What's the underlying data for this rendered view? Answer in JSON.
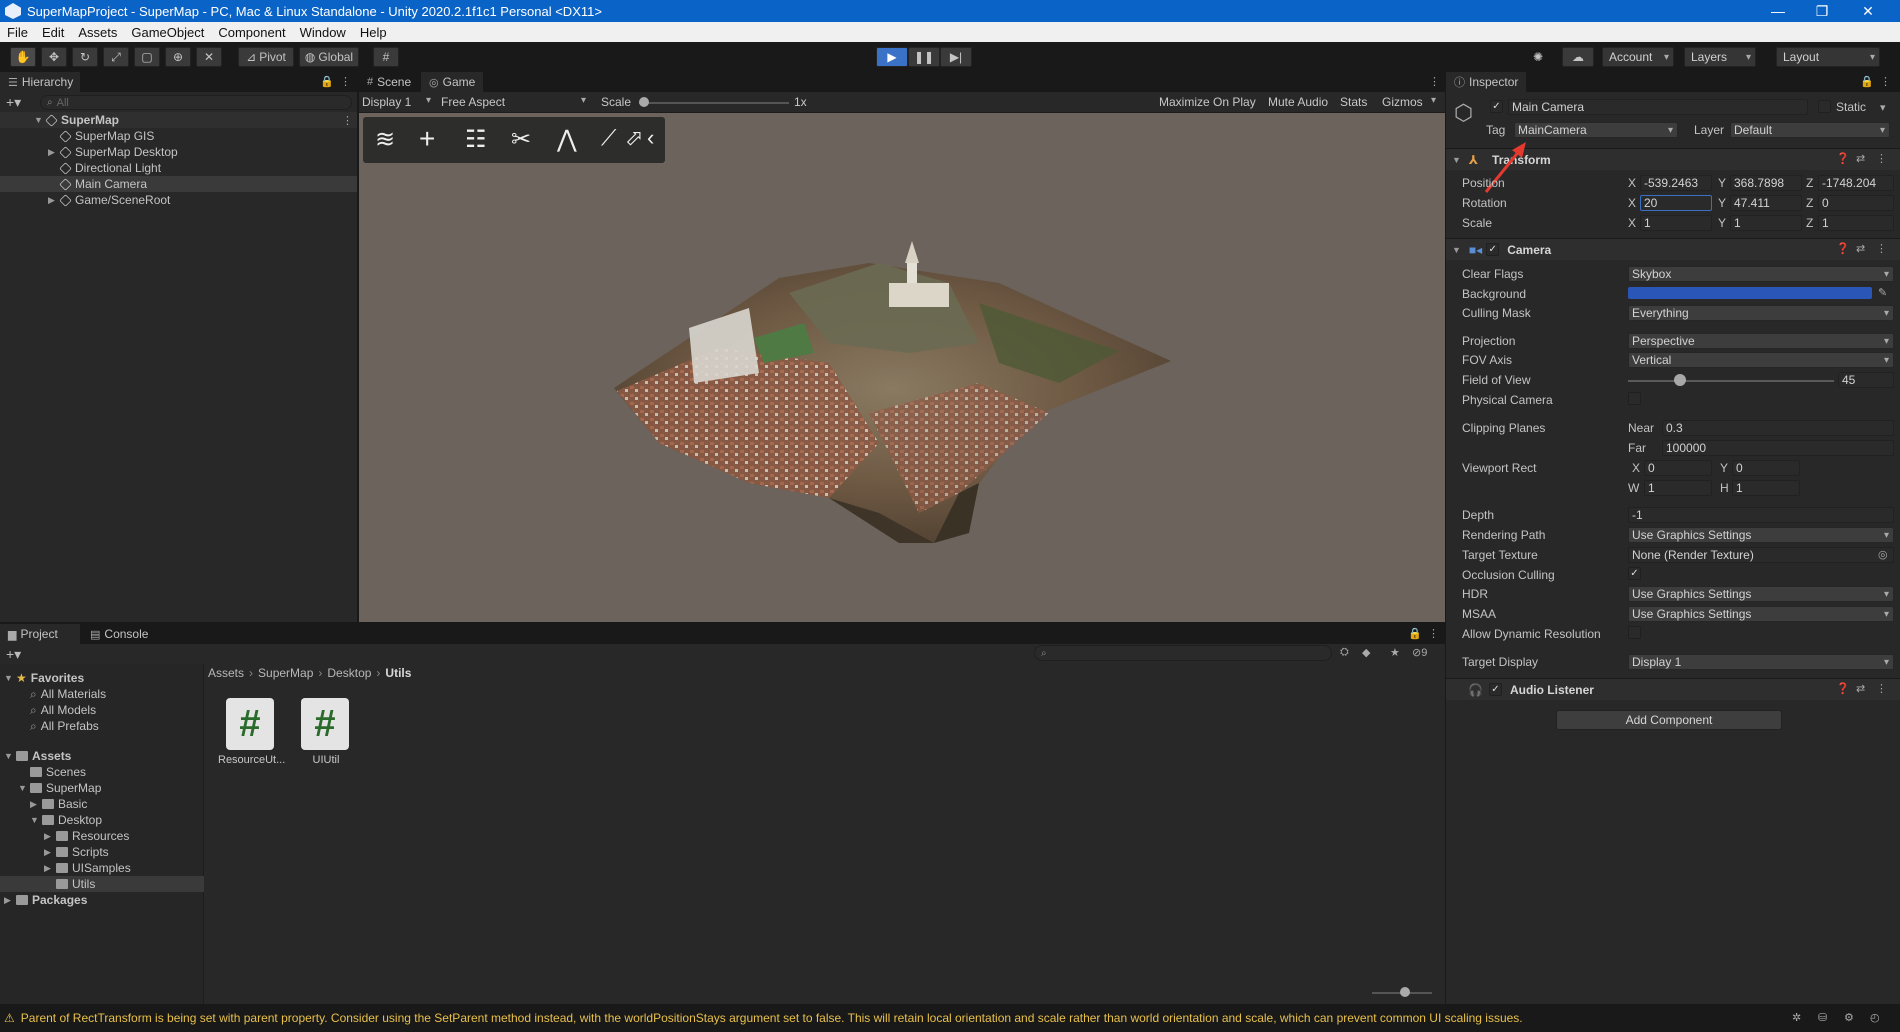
{
  "window": {
    "title": "SuperMapProject - SuperMap - PC, Mac & Linux Standalone - Unity 2020.2.1f1c1 Personal <DX11>",
    "minimize": "—",
    "maximize": "❐",
    "close": "✕"
  },
  "menu": [
    "File",
    "Edit",
    "Assets",
    "GameObject",
    "Component",
    "Window",
    "Help"
  ],
  "toolbar": {
    "pivot_label": "Pivot",
    "global_label": "Global",
    "account_label": "Account",
    "layers_label": "Layers",
    "layout_label": "Layout"
  },
  "hierarchy": {
    "tab_label": "Hierarchy",
    "search_placeholder": "All",
    "items": [
      {
        "label": "SuperMap"
      },
      {
        "label": "SuperMap GIS"
      },
      {
        "label": "SuperMap Desktop"
      },
      {
        "label": "Directional Light"
      },
      {
        "label": "Main Camera"
      },
      {
        "label": "Game/SceneRoot"
      }
    ]
  },
  "scene": {
    "tab_scene": "Scene",
    "tab_game": "Game",
    "display_label": "Display 1",
    "aspect_label": "Free Aspect",
    "scale_label": "Scale",
    "scale_value": "1x",
    "maximize_label": "Maximize On Play",
    "mute_label": "Mute Audio",
    "stats_label": "Stats",
    "gizmos_label": "Gizmos"
  },
  "project": {
    "tab_project": "Project",
    "tab_console": "Console",
    "favorites_label": "Favorites",
    "favorites": [
      "All Materials",
      "All Models",
      "All Prefabs"
    ],
    "assets_label": "Assets",
    "assets_tree": [
      {
        "label": "Scenes"
      },
      {
        "label": "SuperMap"
      },
      {
        "label": "Basic"
      },
      {
        "label": "Desktop"
      },
      {
        "label": "Resources"
      },
      {
        "label": "Scripts"
      },
      {
        "label": "UISamples"
      },
      {
        "label": "Utils"
      }
    ],
    "packages_label": "Packages",
    "breadcrumb": [
      "Assets",
      "SuperMap",
      "Desktop",
      "Utils"
    ],
    "files": [
      "ResourceUt...",
      "UIUtil"
    ],
    "hidden_count": "9"
  },
  "inspector": {
    "tab_label": "Inspector",
    "object_name": "Main Camera",
    "static_label": "Static",
    "tag_label": "Tag",
    "tag_value": "MainCamera",
    "layer_label": "Layer",
    "layer_value": "Default",
    "transform": {
      "title": "Transform",
      "position_label": "Position",
      "rotation_label": "Rotation",
      "scale_label": "Scale",
      "position": {
        "x": "-539.2463",
        "y": "368.7898",
        "z": "-1748.204"
      },
      "rotation": {
        "x": "20",
        "y": "47.411",
        "z": "0"
      },
      "scale": {
        "x": "1",
        "y": "1",
        "z": "1"
      }
    },
    "camera": {
      "title": "Camera",
      "clear_flags_label": "Clear Flags",
      "clear_flags": "Skybox",
      "background_label": "Background",
      "background_color": "#2a56b8",
      "culling_mask_label": "Culling Mask",
      "culling_mask": "Everything",
      "projection_label": "Projection",
      "projection": "Perspective",
      "fov_axis_label": "FOV Axis",
      "fov_axis": "Vertical",
      "fov_label": "Field of View",
      "fov": "45",
      "fov_fraction": 0.25,
      "physical_label": "Physical Camera",
      "clipping_label": "Clipping Planes",
      "near_label": "Near",
      "near": "0.3",
      "far_label": "Far",
      "far": "100000",
      "viewport_label": "Viewport Rect",
      "vp_x": "0",
      "vp_y": "0",
      "vp_w": "1",
      "vp_h": "1",
      "depth_label": "Depth",
      "depth": "-1",
      "render_path_label": "Rendering Path",
      "render_path": "Use Graphics Settings",
      "target_texture_label": "Target Texture",
      "target_texture": "None (Render Texture)",
      "occlusion_label": "Occlusion Culling",
      "hdr_label": "HDR",
      "hdr": "Use Graphics Settings",
      "msaa_label": "MSAA",
      "msaa": "Use Graphics Settings",
      "dyn_res_label": "Allow Dynamic Resolution",
      "target_display_label": "Target Display",
      "target_display": "Display 1"
    },
    "audio_listener": {
      "title": "Audio Listener"
    },
    "add_component_label": "Add Component"
  },
  "status": {
    "message": "Parent of RectTransform is being set with parent property. Consider using the SetParent method instead, with the worldPositionStays argument set to false. This will retain local orientation and scale rather than world orientation and scale, which can prevent common UI scaling issues."
  },
  "colors": {
    "accent": "#0a64c8",
    "play_active": "#3a72c8"
  }
}
